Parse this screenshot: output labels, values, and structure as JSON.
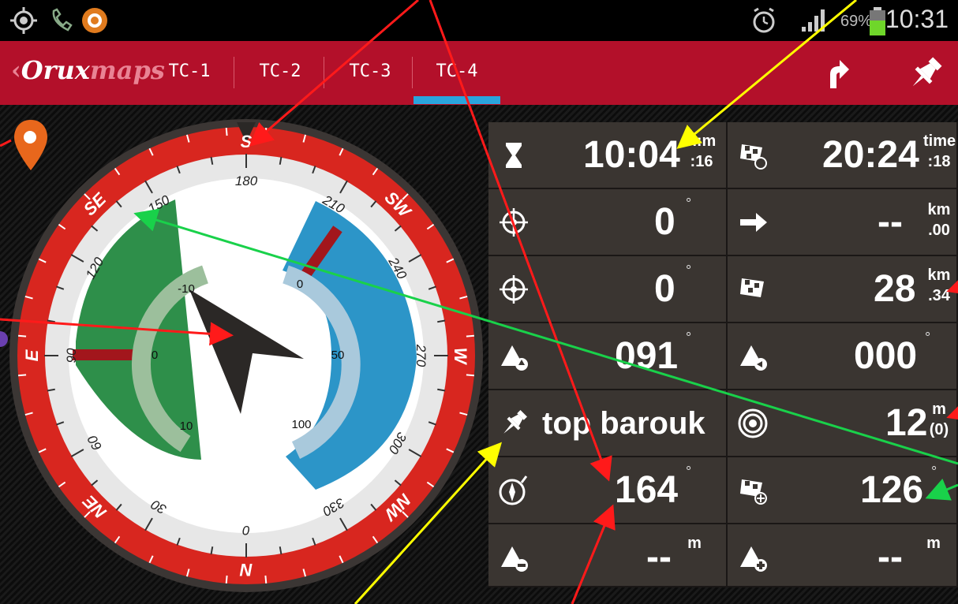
{
  "status": {
    "time": "10:31",
    "battery_text": "69%"
  },
  "app": {
    "brand_bold": "Orux",
    "brand_light": "maps",
    "tabs": [
      "TC-1",
      "TC-2",
      "TC-3",
      "TC-4"
    ],
    "active_tab": "TC-4"
  },
  "compass": {
    "outer_cardinals": [
      "S",
      "SW",
      "W",
      "NW",
      "N",
      "NE",
      "E",
      "SE"
    ],
    "degree_labels": [
      "180",
      "210",
      "240",
      "270",
      "300",
      "330",
      "0",
      "30",
      "60",
      "90",
      "120",
      "150"
    ],
    "inner_labels_left": [
      "-10",
      "0",
      "10"
    ],
    "inner_labels_right": [
      "0",
      "50",
      "100"
    ]
  },
  "cells": {
    "time_elapsed": {
      "main": "10:04",
      "unit_top": "h:m",
      "unit_bottom": ":16",
      "icon": "hourglass-icon"
    },
    "eta_time": {
      "main": "20:24",
      "unit_top": "time",
      "unit_bottom": ":18",
      "icon": "checkered-flag-clock-icon"
    },
    "bearing_1": {
      "main": "0",
      "deg": "°",
      "icon": "crosshair-icon"
    },
    "distance_next": {
      "main": "--",
      "unit_top": "km",
      "unit_bottom": ".00",
      "icon": "direction-arrow-icon"
    },
    "bearing_2": {
      "main": "0",
      "deg": "°",
      "icon": "crosshair-icon"
    },
    "distance_finish": {
      "main": "28",
      "unit_top": "km",
      "unit_bottom": ".34",
      "icon": "checkered-flag-icon"
    },
    "heading_up": {
      "main": "091",
      "deg": "°",
      "icon": "mountain-up-icon"
    },
    "heading_left": {
      "main": "000",
      "deg": "°",
      "icon": "mountain-left-icon"
    },
    "waypoint": {
      "main": "top barouk",
      "icon": "pin-icon"
    },
    "accuracy": {
      "main": "12",
      "unit_top": "m",
      "unit_bottom": "(0)",
      "icon": "gps-accuracy-icon"
    },
    "compass_heading": {
      "main": "164",
      "deg": "°",
      "icon": "compass-icon"
    },
    "target_bearing": {
      "main": "126",
      "deg": "°",
      "icon": "checkered-flag-target-icon"
    },
    "descent": {
      "main": "--",
      "unit_top": "m",
      "icon": "mountain-minus-icon"
    },
    "ascent": {
      "main": "--",
      "unit_top": "m",
      "icon": "mountain-plus-icon"
    }
  },
  "colors": {
    "appbar": "#b3102a",
    "tab_indicator": "#2aa4dd",
    "compass_red": "#d8261f",
    "compass_green": "#2e8f4a",
    "compass_blue": "#2c95c8",
    "cell_bg": "#3a3531"
  }
}
